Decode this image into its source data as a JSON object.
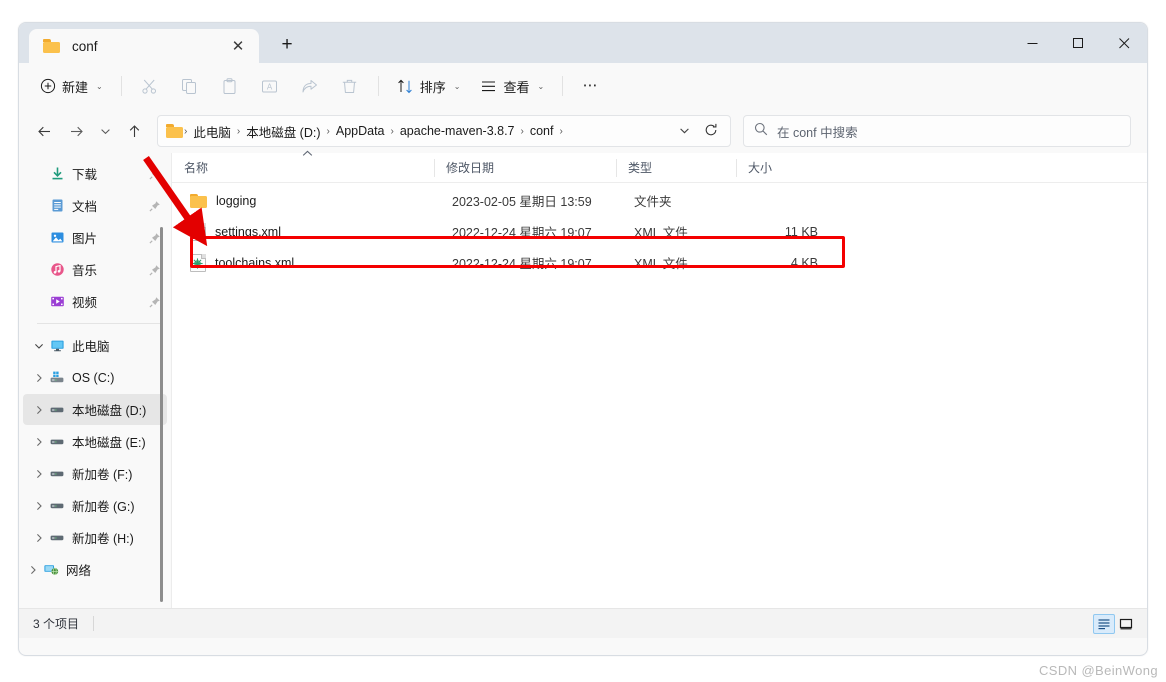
{
  "window": {
    "tab": {
      "title": "conf",
      "icon": "folder-icon",
      "close_label": "✕"
    },
    "new_tab_label": "+",
    "controls": {
      "minimize": "—",
      "maximize": "□",
      "close": "✕"
    }
  },
  "toolbar": {
    "new_label": "新建",
    "cut_label": "剪切",
    "copy_label": "复制",
    "paste_label": "粘贴",
    "rename_label": "重命名",
    "share_label": "共享",
    "delete_label": "删除",
    "sort_label": "排序",
    "view_label": "查看",
    "more_label": "⋯",
    "caret": "⌄"
  },
  "address": {
    "back": "←",
    "forward": "→",
    "recent": "⌄",
    "up": "↑",
    "crumbs": [
      "此电脑",
      "本地磁盘 (D:)",
      "AppData",
      "apache-maven-3.8.7",
      "conf"
    ],
    "separator": "›",
    "dropdown": "⌄",
    "refresh": "↻"
  },
  "search": {
    "placeholder": "在 conf 中搜索",
    "icon": "search-icon"
  },
  "sidebar": {
    "quick_items": [
      {
        "label": "下载",
        "icon": "download-icon",
        "pinned": true
      },
      {
        "label": "文档",
        "icon": "document-icon",
        "pinned": true
      },
      {
        "label": "图片",
        "icon": "pictures-icon",
        "pinned": true
      },
      {
        "label": "音乐",
        "icon": "music-icon",
        "pinned": true
      },
      {
        "label": "视频",
        "icon": "video-icon",
        "pinned": true
      }
    ],
    "this_pc": {
      "label": "此电脑",
      "icon": "computer-icon",
      "expanded": true,
      "chevron": "⌄"
    },
    "drives": [
      {
        "label": "OS (C:)",
        "icon": "windows-drive-icon",
        "selected": false,
        "chevron": "›"
      },
      {
        "label": "本地磁盘 (D:)",
        "icon": "drive-icon",
        "selected": true,
        "chevron": "›"
      },
      {
        "label": "本地磁盘 (E:)",
        "icon": "drive-icon",
        "selected": false,
        "chevron": "›"
      },
      {
        "label": "新加卷 (F:)",
        "icon": "drive-icon",
        "selected": false,
        "chevron": "›"
      },
      {
        "label": "新加卷 (G:)",
        "icon": "drive-icon",
        "selected": false,
        "chevron": "›"
      },
      {
        "label": "新加卷 (H:)",
        "icon": "drive-icon",
        "selected": false,
        "chevron": "›"
      }
    ],
    "network": {
      "label": "网络",
      "icon": "network-icon",
      "chevron": "›"
    }
  },
  "file_list": {
    "columns": {
      "name": "名称",
      "date": "修改日期",
      "type": "类型",
      "size": "大小"
    },
    "sort_indicator": "⌃",
    "rows": [
      {
        "name": "logging",
        "icon": "folder-icon",
        "date": "2023-02-05 星期日 13:59",
        "type": "文件夹",
        "size": "",
        "highlighted": false
      },
      {
        "name": "settings.xml",
        "icon": "xml-file-icon",
        "date": "2022-12-24 星期六 19:07",
        "type": "XML 文件",
        "size": "11 KB",
        "highlighted": true
      },
      {
        "name": "toolchains.xml",
        "icon": "xml-file-icon",
        "date": "2022-12-24 星期六 19:07",
        "type": "XML 文件",
        "size": "4 KB",
        "highlighted": false
      }
    ]
  },
  "status": {
    "item_count": "3 个项目",
    "view_details": "详细信息",
    "view_large_icons": "大图标"
  },
  "annotations": {
    "highlight_color": "#f40000",
    "arrow_color": "#e30000"
  },
  "watermark": "CSDN @BeinWong"
}
